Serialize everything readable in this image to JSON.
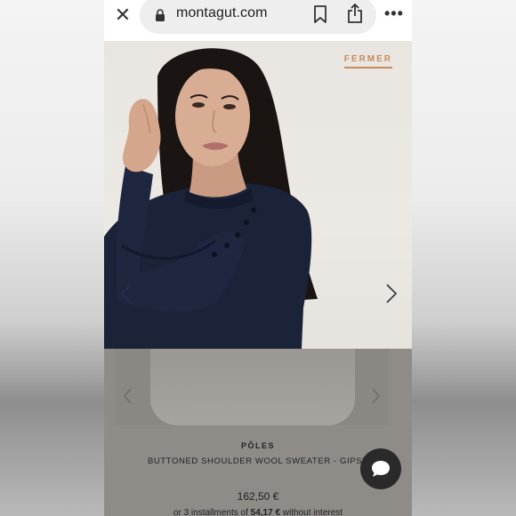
{
  "browser": {
    "url": "montagut.com",
    "close_glyph": "✕",
    "more_glyph": "•••",
    "icons": [
      "close-icon",
      "lock-icon",
      "bookmark-icon",
      "share-icon",
      "more-icon"
    ]
  },
  "gallery": {
    "close_label": "FERMER",
    "next_icon": "chevron-right-icon",
    "prev_icon": "chevron-left-icon"
  },
  "product": {
    "brand": "PÔLES",
    "name": "BUTTONED SHOULDER WOOL SWEATER - GIPSY",
    "price": "162,50 €",
    "installments_prefix": "or 3 installments of ",
    "installments_amount": "54,17 €",
    "installments_suffix": " without interest"
  },
  "chat": {
    "icon": "chat-bubble-icon"
  },
  "colors": {
    "accent": "#c38d5d",
    "sweater": "#1b2338",
    "overlay": "#8f8c88"
  }
}
